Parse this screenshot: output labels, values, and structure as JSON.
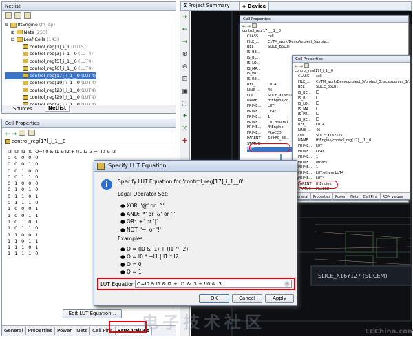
{
  "netlist": {
    "title": "Netlist",
    "root": "fftEngine",
    "root_suffix": "(fftTop)",
    "nets": "Nets",
    "nets_count": "(253)",
    "leaf": "Leaf Cells",
    "leaf_count": "(143)",
    "items": [
      {
        "name": "control_reg[1]_i_1",
        "type": "(LUT5)"
      },
      {
        "name": "control_reg[3]_i_1__0",
        "type": "(LUT4)"
      },
      {
        "name": "control_reg[5]_i_1__0",
        "type": "(LUT4)"
      },
      {
        "name": "control_reg[6]_i_1__0",
        "type": "(LUT4)"
      },
      {
        "name": "control_reg[17]_i_1__0",
        "type": "(LUT4)"
      },
      {
        "name": "control_reg[19]_i_1__0",
        "type": "(LUT4)"
      },
      {
        "name": "control_reg[23]_i_1__0",
        "type": "(LUT4)"
      },
      {
        "name": "control_reg[29]_i_1__0",
        "type": "(LUT4)"
      },
      {
        "name": "control_reg[31]_i_1__0",
        "type": "(LUT4)"
      }
    ],
    "tab_sources": "Sources",
    "tab_netlist": "Netlist"
  },
  "cellprops": {
    "title": "Cell Properties",
    "cell": "control_reg[17]_i_1__0",
    "headers": [
      "I3",
      "I2",
      "I1",
      "I0",
      "O=!I0 & I1 & I2 + !I1 & I3 + !I0 & I3"
    ],
    "rows": [
      [
        "0",
        "0",
        "0",
        "0",
        "0"
      ],
      [
        "0",
        "0",
        "0",
        "1",
        "0"
      ],
      [
        "0",
        "0",
        "1",
        "0",
        "0"
      ],
      [
        "0",
        "0",
        "1",
        "1",
        "0"
      ],
      [
        "0",
        "1",
        "0",
        "0",
        "0"
      ],
      [
        "0",
        "1",
        "0",
        "1",
        "0"
      ],
      [
        "0",
        "1",
        "1",
        "0",
        "1"
      ],
      [
        "0",
        "1",
        "1",
        "1",
        "0"
      ],
      [
        "1",
        "0",
        "0",
        "0",
        "1"
      ],
      [
        "1",
        "0",
        "0",
        "1",
        "1"
      ],
      [
        "1",
        "0",
        "1",
        "0",
        "1"
      ],
      [
        "1",
        "0",
        "1",
        "1",
        "0"
      ],
      [
        "1",
        "1",
        "0",
        "0",
        "1"
      ],
      [
        "1",
        "1",
        "0",
        "1",
        "1"
      ],
      [
        "1",
        "1",
        "1",
        "0",
        "1"
      ],
      [
        "1",
        "1",
        "1",
        "1",
        "0"
      ]
    ],
    "edit_button": "Edit LUT Equation...",
    "tabs": [
      "General",
      "Properties",
      "Power",
      "Nets",
      "Cell Pins",
      "ROM values"
    ]
  },
  "top_tabs": {
    "project_summary": "Project Summary",
    "device": "Device"
  },
  "dialog": {
    "title": "Specify LUT Equation",
    "heading": "Specify LUT Equation for 'control_reg[17]_i_1__0'",
    "legal": "Legal Operator Set:",
    "ops": [
      "XOR: '@' or '^'",
      "AND: '*' or '&' or '.'",
      "OR: '+' or '|'",
      "NOT: '~' or '!'"
    ],
    "examples": "Examples:",
    "ex": [
      "O = (I0 & I1) + (I1 ^ I2)",
      "O = I0 * ~I1 | I1 * I2",
      "O = 0",
      "O = 1"
    ],
    "field_label": "LUT Equation:",
    "field_value": "O=I0 & I1 & I2 + !I1 & I3 + !I0 & I3",
    "ok": "OK",
    "cancel": "Cancel",
    "apply": "Apply"
  },
  "inset1": {
    "title": "Cell Properties",
    "cell": "control_reg[17]_i_1__0",
    "keys": [
      "CLASS",
      "FILE_...",
      "BEL",
      "IS_BE...",
      "IS_BL...",
      "IS_LO...",
      "IS_MA...",
      "IS_PR...",
      "IS_RE...",
      "REF_...",
      "LINE_...",
      "LOC",
      "NAME",
      "PRIME...",
      "PRIME...",
      "PRIME...",
      "PRIME...",
      "PRIME...",
      "PRIME...",
      "PARENT",
      "STATUS",
      "INIT"
    ],
    "vals": [
      "cell",
      "C:/TM_work/Demo/project_5/proje...",
      "SLICE_B6LUT",
      "",
      "",
      "",
      "",
      "",
      "",
      "LUT4",
      "46",
      "SLICE_X16Y127",
      "fftEngine/co...",
      "LUT",
      "LEAF",
      "1",
      "LUT.others.L...",
      "fftEngine",
      "PLACED",
      "64'hF0_BE...",
      "",
      ""
    ],
    "tabs": [
      "General",
      "Properties",
      "Power"
    ]
  },
  "inset2": {
    "title": "Cell Properties",
    "cell": "control_reg[17]_i_1__0",
    "keys": [
      "CLASS",
      "FILE_...",
      "BEL",
      "IS_BE...",
      "IS_BL...",
      "IS_LO...",
      "IS_MA...",
      "IS_PR...",
      "IS_RE...",
      "REF_...",
      "LINE_...",
      "LOC",
      "NAME",
      "PRIME...",
      "PRIME...",
      "PRIME...",
      "PRIME...",
      "PRIME...",
      "PRIME...",
      "PRIME...",
      "PARENT",
      "STATUS",
      "INIT"
    ],
    "vals": [
      "cell",
      "C:/TM_work/Demo/project_5/project_5.srcs/sources_1/...",
      "SLICE_B6LUT",
      "",
      "",
      "",
      "",
      "",
      "",
      "LUT4",
      "46",
      "SLICE_X16Y127",
      "fftEngine/control_reg[17]_i_1__0",
      "LUT",
      "LEAF",
      "1",
      "others",
      "1",
      "LUT.others.LUT4",
      "LUT4",
      "fftEngine",
      "PLACED",
      "64'hF0B4"
    ],
    "tabs": [
      "General",
      "Properties",
      "Power",
      "Nets",
      "Cell Pins",
      "ROM values"
    ]
  },
  "device": {
    "slice_label": "SLICE_X16Y127 (SLICEM)"
  },
  "watermark": {
    "text": "EEChina.com",
    "cn": "电子技术社区"
  },
  "colors": {
    "selection": "#3b74c9",
    "highlight": "#e8000d",
    "device_bg": "#0d0f12",
    "dialog_bg": "#f0f0f0"
  }
}
